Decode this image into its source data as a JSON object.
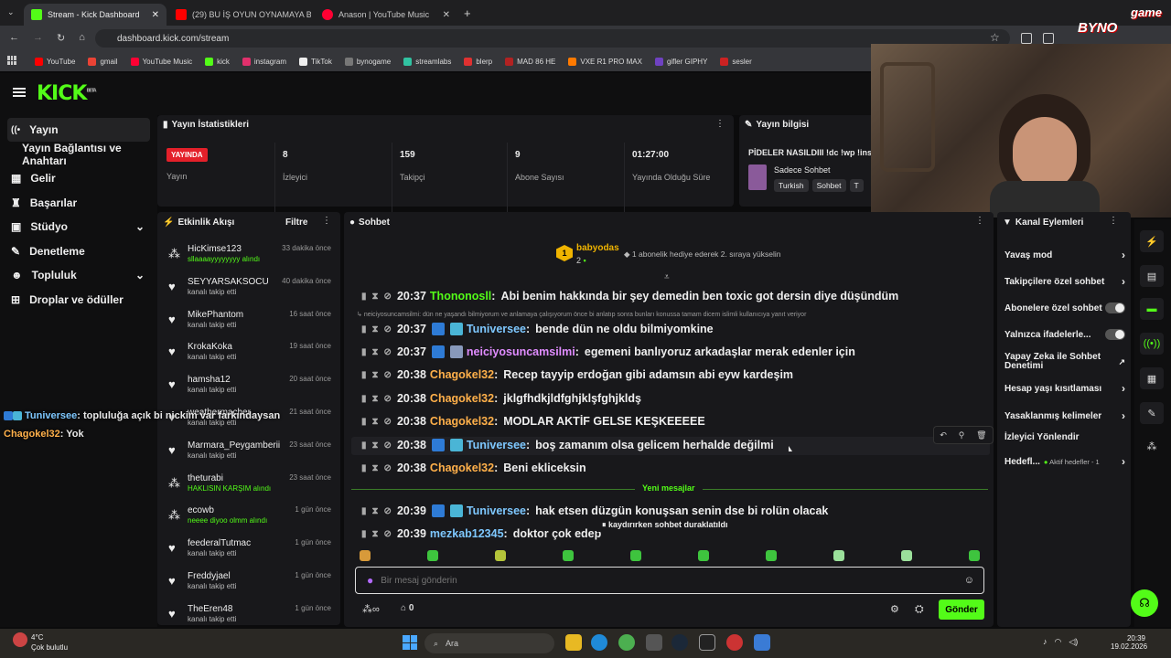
{
  "browser": {
    "tabs": [
      {
        "title": "Stream - Kick Dashboard",
        "color": "#53fc18"
      },
      {
        "title": "(29) BU İŞ OYUN OYNAMAYA B",
        "color": "#ff0000"
      },
      {
        "title": "Anason | YouTube Music",
        "color": "#ff0033"
      }
    ],
    "url": "dashboard.kick.com/stream",
    "bookmarks": [
      "YouTube",
      "gmail",
      "YouTube Music",
      "kick",
      "instagram",
      "TikTok",
      "bynogame",
      "streamlabs",
      "blerp",
      "MAD 86 HE",
      "VXE R1 PRO MAX",
      "gifler GIPHY",
      "sesler"
    ],
    "bookmark_colors": [
      "#ff0000",
      "#ea4335",
      "#ff0033",
      "#53fc18",
      "#e1306c",
      "#eeeeee",
      "#777777",
      "#31c3a2",
      "#e03131",
      "#b22222",
      "#ff7a00",
      "#6f42c1",
      "#cc2222"
    ]
  },
  "app": {
    "logo": "KICK",
    "beta": "BETA"
  },
  "sidebar": {
    "items": [
      "Yayın",
      "Yayın Bağlantısı ve Anahtarı",
      "Gelir",
      "Başarılar",
      "Stüdyo",
      "Denetleme",
      "Topluluk",
      "Droplar ve ödüller"
    ]
  },
  "stats": {
    "title": "Yayın İstatistikleri",
    "live_badge": "YAYINDA",
    "live_label": "Yayın",
    "items": [
      {
        "value": "8",
        "label": "İzleyici"
      },
      {
        "value": "159",
        "label": "Takipçi"
      },
      {
        "value": "9",
        "label": "Abone Sayısı"
      },
      {
        "value": "01:27:00",
        "label": "Yayında Olduğu Süre"
      }
    ]
  },
  "info": {
    "title": "Yayın bilgisi",
    "stream_title": "PİDELER NASILDIII !dc !wp !ins",
    "category": "Sadece Sohbet",
    "tags": [
      "Turkish",
      "Sohbet",
      "T"
    ]
  },
  "activity": {
    "title": "Etkinlik Akışı",
    "filter": "Filtre",
    "events": [
      {
        "name": "HicKimse123",
        "sub": "sllaaaayyyyyyyy alındı",
        "time": "33 dakika önce",
        "green": true
      },
      {
        "name": "SEYYARSAKSOCU",
        "sub": "kanalı takip etti",
        "time": "40 dakika önce",
        "green": false
      },
      {
        "name": "MikePhantom",
        "sub": "kanalı takip etti",
        "time": "16 saat önce",
        "green": false
      },
      {
        "name": "KrokaKoka",
        "sub": "kanalı takip etti",
        "time": "19 saat önce",
        "green": false
      },
      {
        "name": "hamsha12",
        "sub": "kanalı takip etti",
        "time": "20 saat önce",
        "green": false
      },
      {
        "name": "weathermacher",
        "sub": "kanalı takip etti",
        "time": "21 saat önce",
        "green": false
      },
      {
        "name": "Marmara_Peygamberii",
        "sub": "kanalı takip etti",
        "time": "23 saat önce",
        "green": false
      },
      {
        "name": "theturabi",
        "sub": "HAKLISIN KARŞIM alındı",
        "time": "23 saat önce",
        "green": true
      },
      {
        "name": "ecowb",
        "sub": "neeee diyoo olmm alındı",
        "time": "1 gün önce",
        "green": true
      },
      {
        "name": "feederalTutmac",
        "sub": "kanalı takip etti",
        "time": "1 gün önce",
        "green": false
      },
      {
        "name": "Freddyjael",
        "sub": "kanalı takip etti",
        "time": "1 gün önce",
        "green": false
      },
      {
        "name": "TheEren48",
        "sub": "kanalı takip etti",
        "time": "1 gün önce",
        "green": false
      }
    ]
  },
  "overlay": {
    "line1_user": "Tuniversee",
    "line1_text": ": topluluğa açık bi nickim var farkındaysan",
    "line2_user": "Chagokel32",
    "line2_text": ": Yok"
  },
  "chat": {
    "title": "Sohbet",
    "pinned_user": "babyodas",
    "pinned_count": "2",
    "pinned_text": "1 abonelik hediye ederek 2. sıraya yükselin",
    "reply_note": "neiciyosuncamsilmi: dün ne yaşandı bilmiyorum ve anlamaya çalışıyorum önce bi anlatıp sonra bunları konussa tamam dicem islimli kullanıcıya yanıt veriyor",
    "messages": [
      {
        "time": "20:37",
        "user": "Thononosll",
        "color": "#53fc18",
        "text": "Abi benim hakkında bir şey demedin ben toxic got dersin diye düşündüm"
      },
      {
        "time": "20:37",
        "user": "Tuniversee",
        "color": "#7ec8ff",
        "text": "bende dün ne oldu bilmiyomkine"
      },
      {
        "time": "20:37",
        "user": "neiciyosuncamsilmi",
        "color": "#e08cff",
        "text": "egemeni banlıyoruz arkadaşlar merak edenler için"
      },
      {
        "time": "20:38",
        "user": "Chagokel32",
        "color": "#ffb04a",
        "text": "Recep tayyip erdoğan gibi adamsın abi eyw kardeşim"
      },
      {
        "time": "20:38",
        "user": "Chagokel32",
        "color": "#ffb04a",
        "text": "jklgfhdkjldfghjklşfghjkldş"
      },
      {
        "time": "20:38",
        "user": "Chagokel32",
        "color": "#ffb04a",
        "text": "MODLAR AKTİF GELSE KEŞKEEEEE"
      },
      {
        "time": "20:38",
        "user": "Tuniversee",
        "color": "#7ec8ff",
        "text": "boş zamanım olsa gelicem herhalde değilmi"
      },
      {
        "time": "20:38",
        "user": "Chagokel32",
        "color": "#ffb04a",
        "text": "Beni ekliceksin"
      },
      {
        "time": "20:39",
        "user": "Tuniversee",
        "color": "#7ec8ff",
        "text": "hak etsen düzgün konuşsan senin dse bi rolün olacak"
      },
      {
        "time": "20:39",
        "user": "mezkab12345",
        "color": "#7ec8ff",
        "text": "doktor çok edep"
      }
    ],
    "new_messages": "Yeni mesajlar",
    "paused": "kaydırırken sohbet duraklatıldı",
    "input_placeholder": "Bir mesaj gönderin",
    "points": "0",
    "send": "Gönder"
  },
  "actions": {
    "title": "Kanal Eylemleri",
    "items": [
      "Yavaş mod",
      "Takipçilere özel sohbet",
      "Abonelere özel sohbet",
      "Yalnızca ifadelerle...",
      "Yapay Zeka ile Sohbet Denetimi",
      "Hesap yaşı kısıtlaması",
      "Yasaklanmış kelimeler",
      "İzleyici Yönlendir",
      "Hedefl..."
    ],
    "goal_sub": "Aktif hedefler - 1"
  },
  "taskbar": {
    "weather_temp": "4°C",
    "weather_desc": "Çok bulutlu",
    "search": "Ara",
    "time": "20:39",
    "date": "19.02.2026"
  },
  "webcam": {
    "brand": "BYNO",
    "brand_sub": "game"
  }
}
